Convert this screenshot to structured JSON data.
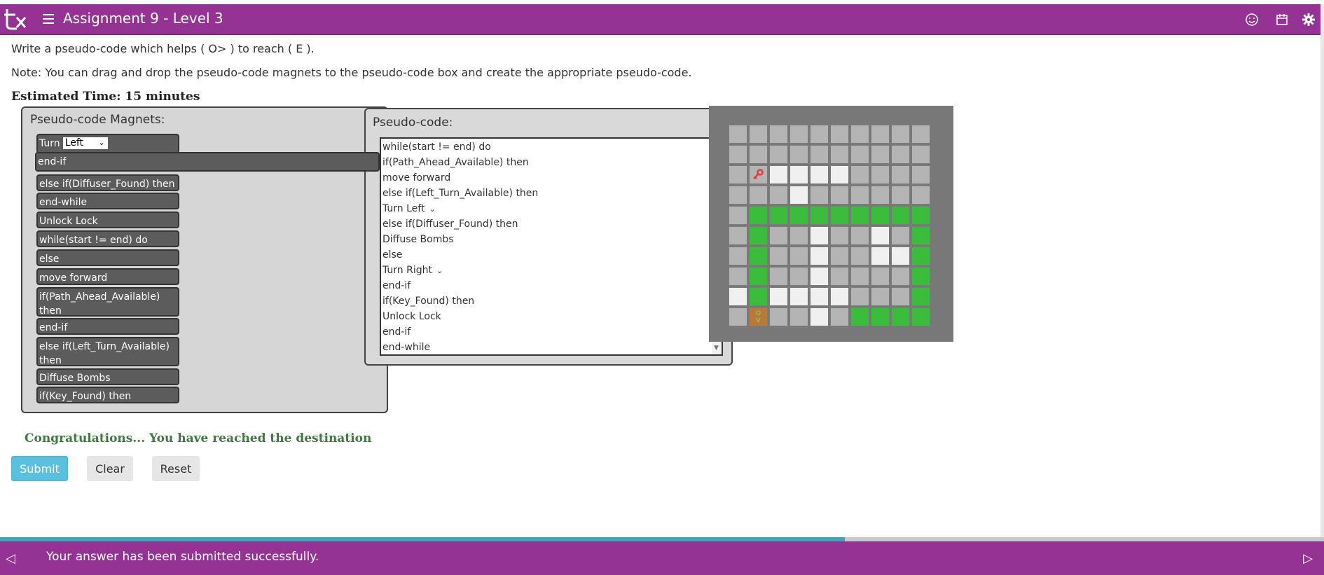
{
  "header": {
    "title": "Assignment 9 - Level 3",
    "icons": [
      "logo-icon",
      "menu-icon",
      "smiley-icon",
      "calendar-icon",
      "gear-icon"
    ]
  },
  "instructions": {
    "line1": "Write a pseudo-code which helps ( O> ) to reach ( E ).",
    "line2": "Note: You can drag and drop the pseudo-code magnets to the pseudo-code box and create the appropriate pseudo-code.",
    "estimated_time": "Estimated Time: 15 minutes"
  },
  "magnets": {
    "title": "Pseudo-code Magnets:",
    "turn_prefix": "Turn",
    "turn_value": "Left",
    "floating": "end-if",
    "items": [
      "else if(Diffuser_Found) then",
      "end-while",
      "Unlock Lock",
      "while(start != end) do",
      "else",
      "move forward",
      "if(Path_Ahead_Available) then",
      "end-if",
      "else  if(Left_Turn_Available) then",
      "Diffuse Bombs",
      "if(Key_Found) then"
    ]
  },
  "pseudocode": {
    "title": "Pseudo-code:",
    "lines": [
      "while(start != end) do",
      "if(Path_Ahead_Available) then",
      "move forward",
      "else if(Left_Turn_Available) then",
      "Turn  Left",
      "else if(Diffuser_Found) then",
      "Diffuse Bombs",
      "else",
      "Turn  Right",
      "end-if",
      "if(Key_Found) then",
      "Unlock Lock",
      "end-if",
      "end-while"
    ]
  },
  "maze": {
    "colors": {
      "wall": "#b4b4b4",
      "path": "#f0f0f0",
      "visited": "#3cbc3c",
      "key": "#e53935"
    },
    "grid": [
      "WWWWWWWWWW",
      "WWWWWWWWWW",
      "WKPPPPWWWW",
      "WWWPWWWWWW",
      "WGGGGGGGGG",
      "WGWWPWWPWG",
      "WGWWPWWPPG",
      "WGWWPWWWWG",
      "PGPPPPWWWG",
      "WOWWPWGGGG"
    ],
    "robot_label": "O\nV"
  },
  "messages": {
    "congrats": "Congratulations... You have reached the destination"
  },
  "buttons": {
    "submit": "Submit",
    "clear": "Clear",
    "reset": "Reset"
  },
  "progress": {
    "fraction": 0.638
  },
  "footer": {
    "message": "Your answer has been submitted successfully.",
    "prev": "◁",
    "next": "▷"
  }
}
